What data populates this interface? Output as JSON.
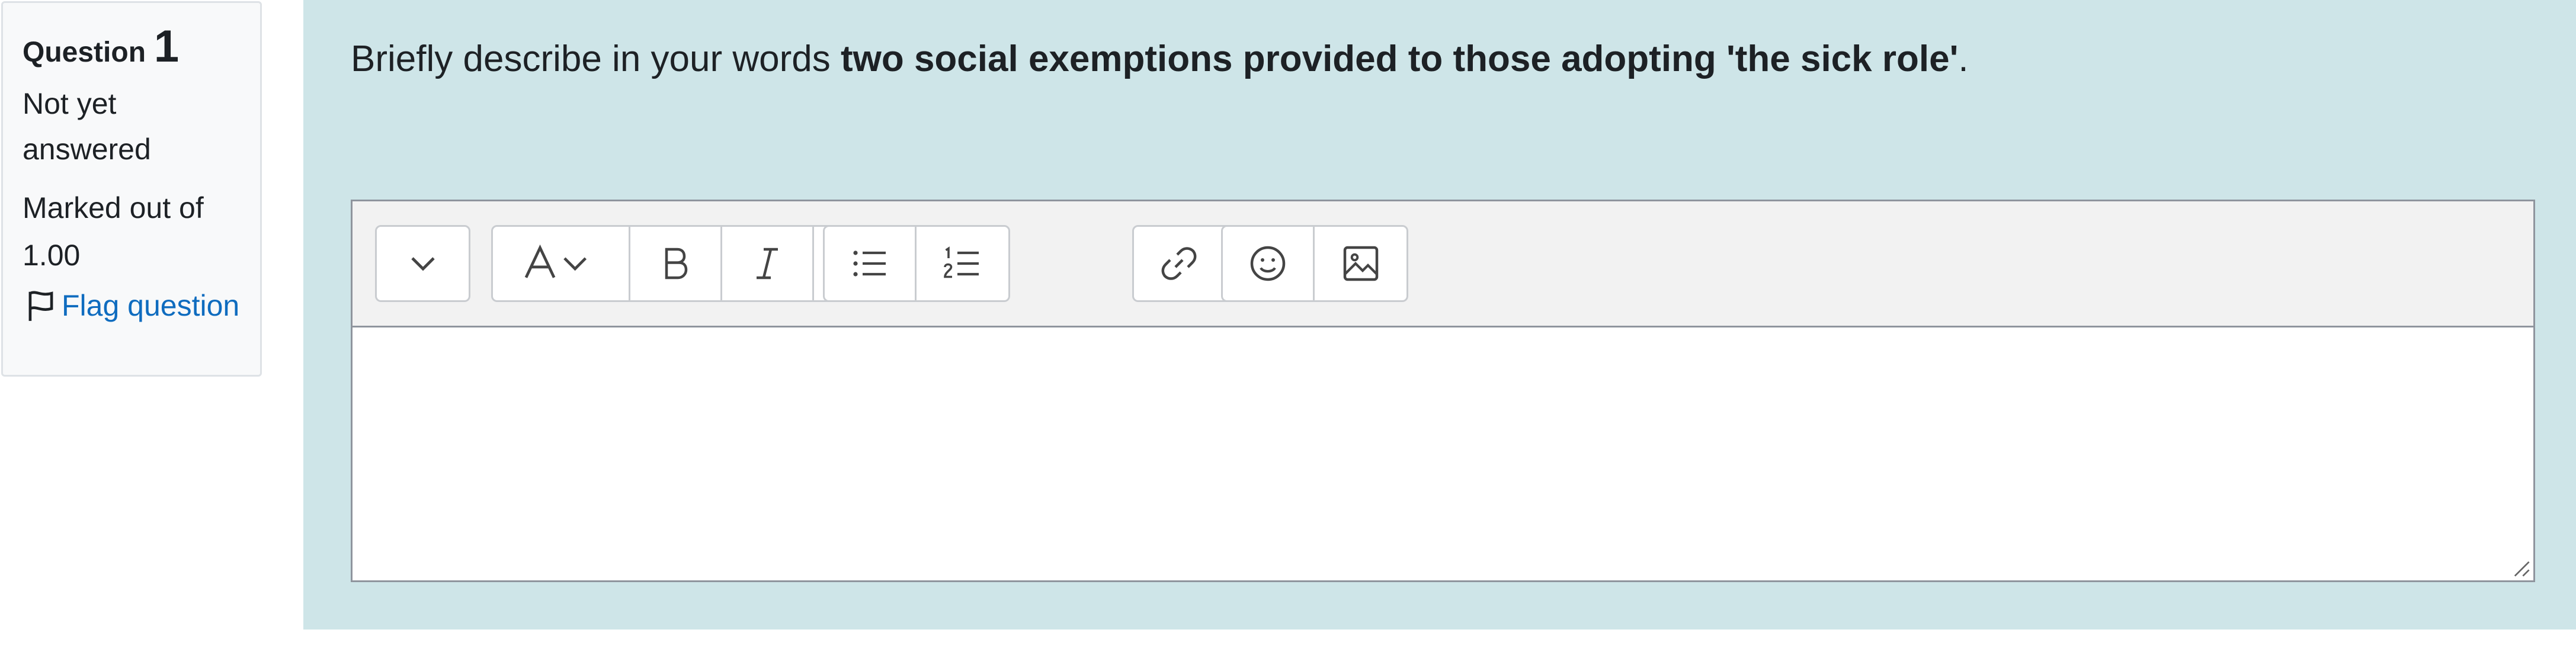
{
  "question_info": {
    "label_word": "Question",
    "number": "1",
    "state": "Not yet answered",
    "grade": "Marked out of 1.00",
    "flag_label": "Flag question"
  },
  "question": {
    "text_prefix": "Briefly describe in your words ",
    "text_bold": "two social exemptions provided to those adopting 'the sick role'",
    "text_suffix": "."
  },
  "editor": {
    "toolbar_buttons": [
      "collapse-menu",
      "font-size",
      "bold",
      "italic",
      "h5p",
      "bullet-list",
      "numbered-list",
      "link",
      "unlink",
      "emoji",
      "image"
    ],
    "answer_value": ""
  },
  "colors": {
    "content_bg": "#cee5e8",
    "link": "#0f6cbf",
    "info_bg": "#f8f9fa"
  }
}
